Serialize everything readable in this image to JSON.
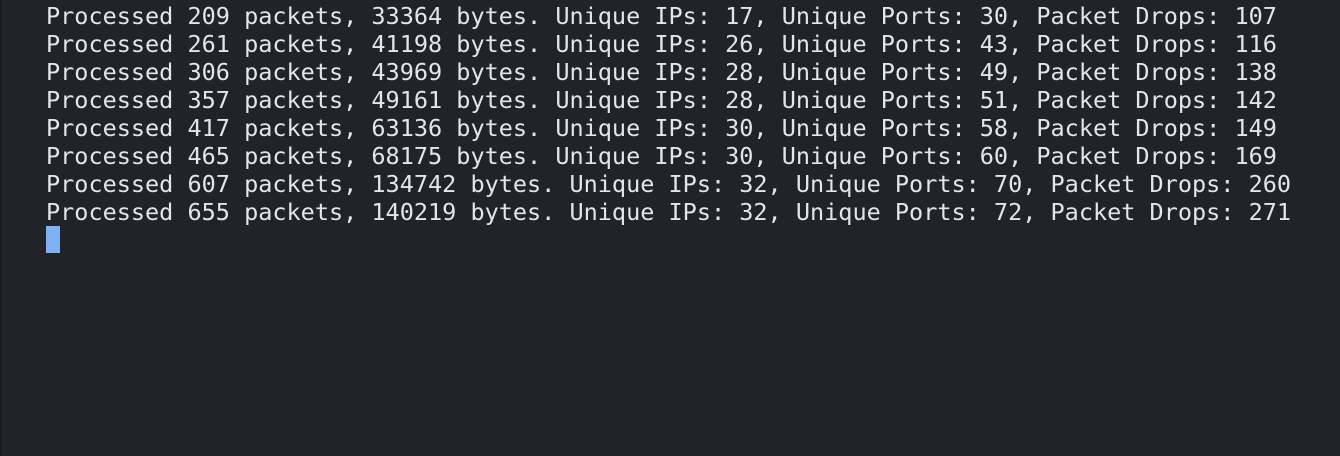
{
  "terminal": {
    "lines": [
      "Processed 209 packets, 33364 bytes. Unique IPs: 17, Unique Ports: 30, Packet Drops: 107",
      "Processed 261 packets, 41198 bytes. Unique IPs: 26, Unique Ports: 43, Packet Drops: 116",
      "Processed 306 packets, 43969 bytes. Unique IPs: 28, Unique Ports: 49, Packet Drops: 138",
      "Processed 357 packets, 49161 bytes. Unique IPs: 28, Unique Ports: 51, Packet Drops: 142",
      "Processed 417 packets, 63136 bytes. Unique IPs: 30, Unique Ports: 58, Packet Drops: 149",
      "Processed 465 packets, 68175 bytes. Unique IPs: 30, Unique Ports: 60, Packet Drops: 169",
      "Processed 607 packets, 134742 bytes. Unique IPs: 32, Unique Ports: 70, Packet Drops: 260",
      "Processed 655 packets, 140219 bytes. Unique IPs: 32, Unique Ports: 72, Packet Drops: 271"
    ],
    "colors": {
      "background": "#212328",
      "text": "#e3e5e8",
      "cursor": "#7fb2f4"
    }
  }
}
